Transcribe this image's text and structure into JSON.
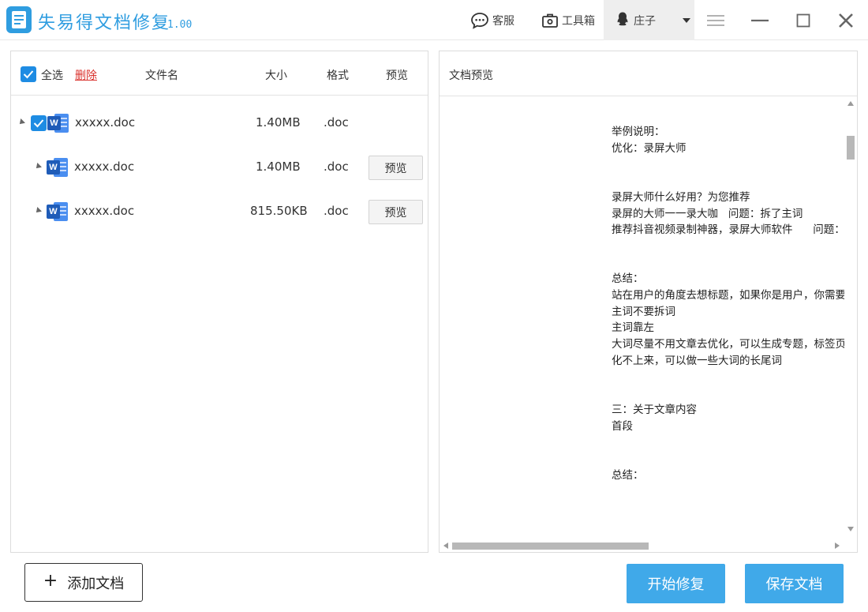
{
  "app": {
    "title": "失易得文档修复",
    "version": "1.00"
  },
  "titlebar": {
    "service_label": "客服",
    "toolbox_label": "工具箱",
    "user_name": "庄子"
  },
  "file_list": {
    "select_all_label": "全选",
    "delete_label": "删除",
    "columns": {
      "name": "文件名",
      "size": "大小",
      "format": "格式",
      "preview": "预览"
    },
    "rows": [
      {
        "name": "xxxxx.doc",
        "size": "1.40MB",
        "format": ".doc",
        "checked": true,
        "is_group": true
      },
      {
        "name": "xxxxx.doc",
        "size": "1.40MB",
        "format": ".doc",
        "preview_label": "预览"
      },
      {
        "name": "xxxxx.doc",
        "size": "815.50KB",
        "format": ".doc",
        "preview_label": "预览"
      }
    ]
  },
  "preview": {
    "header": "文档预览",
    "lines": [
      "举例说明：",
      "优化：录屏大师",
      "",
      "",
      "录屏大师什么好用？为您推荐",
      "录屏的大师一一录大咖   问题：拆了主词",
      "推荐抖音视频录制神器，录屏大师软件      问题：主",
      "",
      "",
      "总结：",
      "站在用户的角度去想标题，如果你是用户，你需要搜",
      "主词不要拆词",
      "主词靠左",
      "大词尽量不用文章去优化，可以生成专题，标签页去",
      "化不上来，可以做一些大词的长尾词",
      "",
      "",
      "三：关于文章内容",
      "首段",
      "",
      "",
      "总结："
    ]
  },
  "actions": {
    "add_label": "添加文档",
    "repair_label": "开始修复",
    "save_label": "保存文档"
  },
  "colors": {
    "accent": "#2f9de0",
    "button_blue": "#40a9e9",
    "checkbox_blue": "#1e8ce3",
    "delete_red": "#d9302b"
  }
}
